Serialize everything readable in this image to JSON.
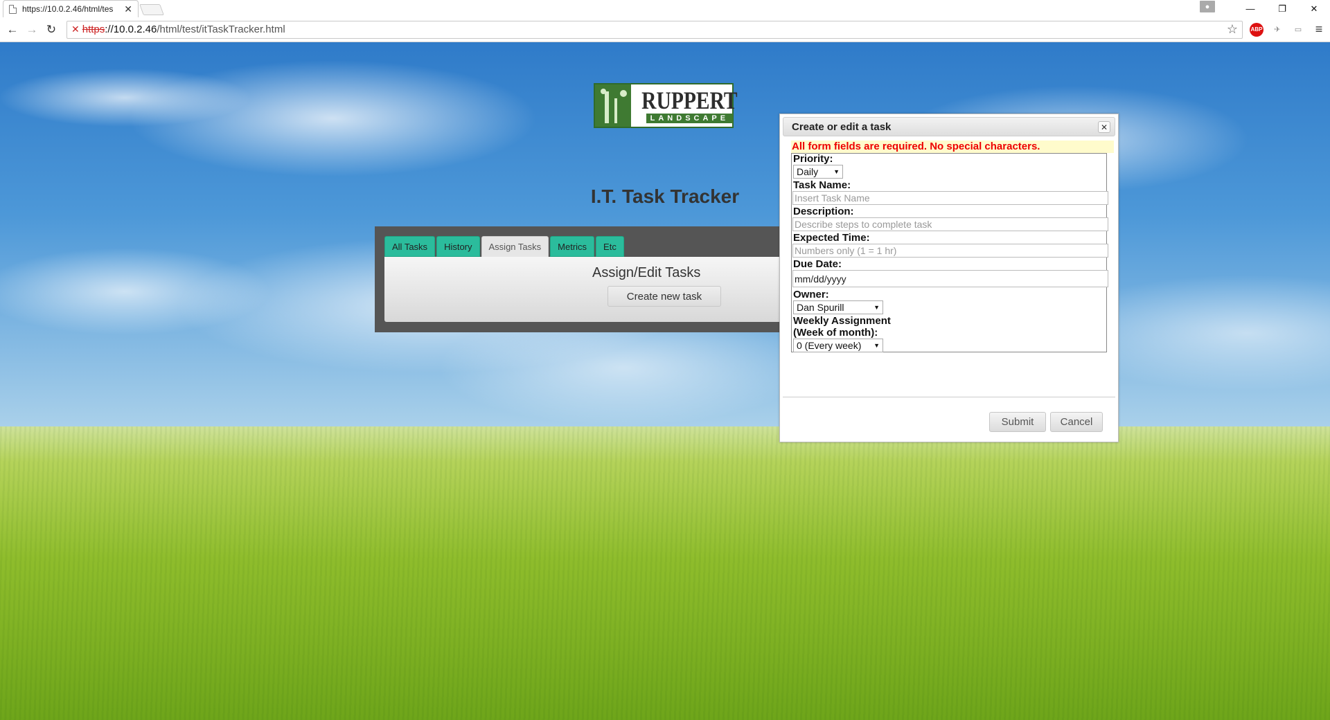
{
  "browser": {
    "tab_title": "https://10.0.2.46/html/tes",
    "tab_close": "✕",
    "url_scheme": "https",
    "url_host": "://10.0.2.46",
    "url_path": "/html/test/itTaskTracker.html",
    "window_controls": [
      "—",
      "❐",
      "✕"
    ]
  },
  "page": {
    "logo_name": "RUPPERT",
    "logo_sub": "LANDSCAPE",
    "title": "I.T. Task Tracker",
    "tabs": [
      {
        "label": "All Tasks"
      },
      {
        "label": "History"
      },
      {
        "label": "Assign Tasks"
      },
      {
        "label": "Metrics"
      },
      {
        "label": "Etc"
      }
    ],
    "active_tab": "Assign Tasks",
    "section_title": "Assign/Edit Tasks",
    "create_button": "Create new task"
  },
  "dialog": {
    "title": "Create or edit a task",
    "close": "✕",
    "required_notice": "All form fields are required. No special characters.",
    "priority_label": "Priority:",
    "priority_value": "Daily",
    "task_name_label": "Task Name:",
    "task_name_placeholder": "Insert Task Name",
    "description_label": "Description:",
    "description_placeholder": "Describe steps to complete task",
    "expected_time_label": "Expected Time:",
    "expected_time_placeholder": "Numbers only (1 = 1 hr)",
    "due_date_label": "Due Date:",
    "due_date_value": "mm/dd/yyyy",
    "owner_label": "Owner:",
    "owner_value": "Dan Spurill",
    "weekly_label_1": "Weekly Assignment",
    "weekly_label_2": "(Week of month):",
    "weekly_value": "0 (Every week)",
    "submit": "Submit",
    "cancel": "Cancel"
  }
}
